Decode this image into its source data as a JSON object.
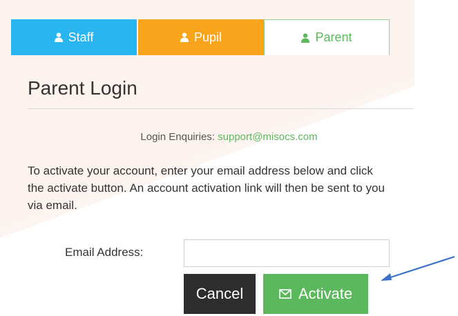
{
  "tabs": [
    {
      "label": "Staff",
      "icon": "user-icon",
      "color": "#29b6f0"
    },
    {
      "label": "Pupil",
      "icon": "user-icon",
      "color": "#f8a51c"
    },
    {
      "label": "Parent",
      "icon": "user-icon",
      "color": "#5cb85c",
      "active": true
    }
  ],
  "page_title": "Parent Login",
  "enquiries": {
    "label": "Login Enquiries:",
    "email": "support@misocs.com"
  },
  "description": "To activate your account, enter your email address below and click the activate button. An account activation link will then be sent to you via email.",
  "email_field": {
    "label": "Email Address:",
    "value": "",
    "placeholder": ""
  },
  "buttons": {
    "cancel": "Cancel",
    "activate": "Activate",
    "activate_icon": "envelope-icon"
  },
  "annotation": {
    "icon": "arrow-pointer-icon",
    "color": "#3b6fc4"
  }
}
